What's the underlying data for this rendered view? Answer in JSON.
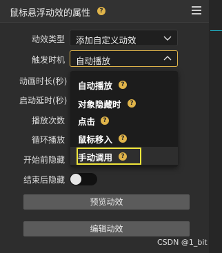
{
  "panel": {
    "title": "鼠标悬浮动效的属性",
    "help_glyph": "?",
    "menu_icon": "hamburger-menu-icon"
  },
  "labels": {
    "effect_type": "动效类型",
    "trigger": "触发时机",
    "duration": "动画时长(秒)",
    "delay": "启动延时(秒)",
    "play_count": "播放次数",
    "loop": "循环播放",
    "hide_before": "开始前隐藏",
    "hide_after": "结束后隐藏"
  },
  "fields": {
    "effect_type_value": "添加自定义动效",
    "trigger_value": "自动播放"
  },
  "trigger_options": [
    {
      "label": "自动播放",
      "help": "?"
    },
    {
      "label": "对象隐藏时",
      "help": "?"
    },
    {
      "label": "点击",
      "help": "?"
    },
    {
      "label": "鼠标移入",
      "help": "?"
    },
    {
      "label": "手动调用",
      "help": "?"
    }
  ],
  "toggle": {
    "hide_after_on": false
  },
  "buttons": {
    "preview": "预览动效",
    "edit": "编辑动效"
  },
  "watermark": "CSDN @1_bit",
  "colors": {
    "help_badge": "#e0b44a",
    "highlight": "#f1e73b",
    "accent_line": "#1fb4c8"
  }
}
